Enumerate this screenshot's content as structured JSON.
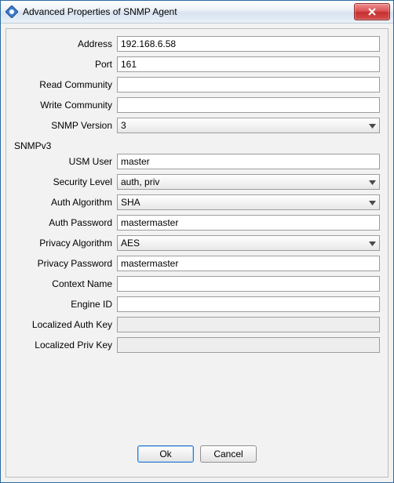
{
  "titlebar": {
    "title": "Advanced Properties of SNMP Agent"
  },
  "fields": {
    "address": {
      "label": "Address",
      "value": "192.168.6.58"
    },
    "port": {
      "label": "Port",
      "value": "161"
    },
    "read_community": {
      "label": "Read Community",
      "value": ""
    },
    "write_community": {
      "label": "Write Community",
      "value": ""
    },
    "snmp_version": {
      "label": "SNMP Version",
      "value": "3"
    }
  },
  "snmpv3": {
    "group_label": "SNMPv3",
    "usm_user": {
      "label": "USM User",
      "value": "master"
    },
    "security_level": {
      "label": "Security Level",
      "value": "auth, priv"
    },
    "auth_algorithm": {
      "label": "Auth Algorithm",
      "value": "SHA"
    },
    "auth_password": {
      "label": "Auth Password",
      "value": "mastermaster"
    },
    "privacy_algorithm": {
      "label": "Privacy Algorithm",
      "value": "AES"
    },
    "privacy_password": {
      "label": "Privacy Password",
      "value": "mastermaster"
    },
    "context_name": {
      "label": "Context Name",
      "value": ""
    },
    "engine_id": {
      "label": "Engine ID",
      "value": ""
    },
    "localized_auth_key": {
      "label": "Localized Auth Key",
      "value": ""
    },
    "localized_priv_key": {
      "label": "Localized Priv Key",
      "value": ""
    }
  },
  "buttons": {
    "ok": "Ok",
    "cancel": "Cancel"
  }
}
